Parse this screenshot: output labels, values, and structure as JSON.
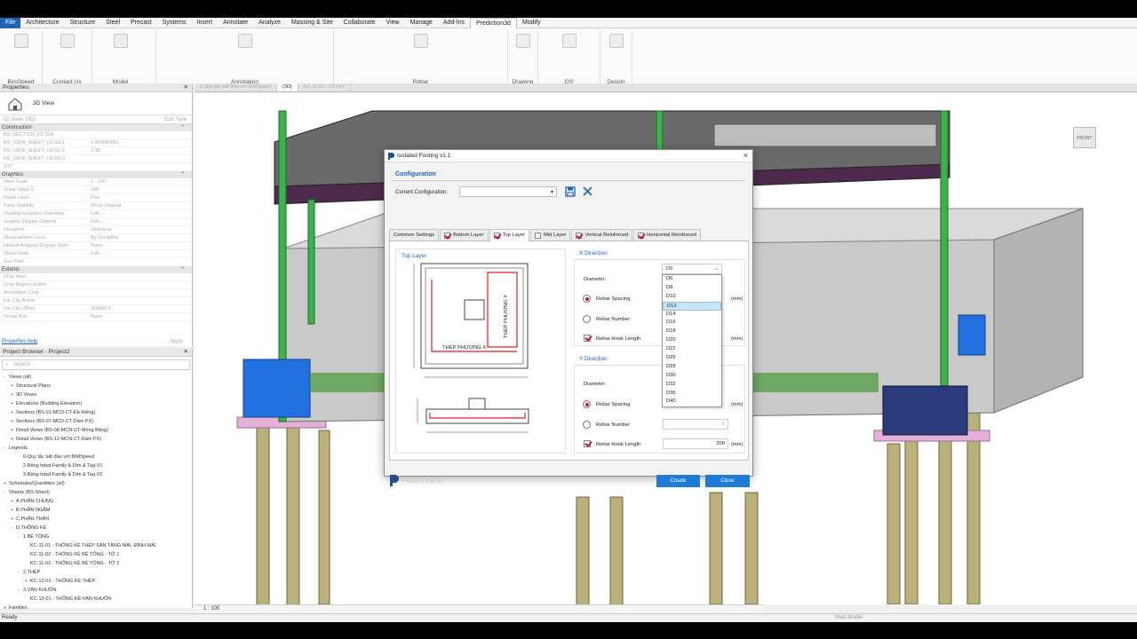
{
  "ribbon": {
    "tabs": [
      "File",
      "Architecture",
      "Structure",
      "Steel",
      "Precast",
      "Systems",
      "Insert",
      "Annotate",
      "Analyze",
      "Massing & Site",
      "Collaborate",
      "View",
      "Manage",
      "Add-Ins",
      "Prediction3d",
      "Modify"
    ],
    "groups": [
      "BimSpeed",
      "Contact Us",
      "Model",
      "Annotation",
      "Rebar",
      "Drawing",
      "QS",
      "Design"
    ]
  },
  "properties": {
    "title": "Properties",
    "view_type": "3D View",
    "view_selector": "3D View: {3D}",
    "edit_type": "Edit Type",
    "sections": {
      "construction": "Construction",
      "graphics": "Graphics",
      "extents": "Extents"
    },
    "construction_rows": [
      {
        "k": "BS_SECTION_FILTER",
        "v": ""
      },
      {
        "k": "BS_VIEW_SHEET_LEVEL1",
        "v": "0 WORKING"
      },
      {
        "k": "BS_VIEW_SHEET_LEVEL2",
        "v": "2.3D"
      },
      {
        "k": "BS_VIEW_SHEET_LEVEL3",
        "v": ""
      },
      {
        "k": "STT",
        "v": ""
      }
    ],
    "graphics_rows": [
      {
        "k": "View Scale",
        "v": "1 : 100"
      },
      {
        "k": "Scale Value    1:",
        "v": "100"
      },
      {
        "k": "Detail Level",
        "v": "Fine"
      },
      {
        "k": "Parts Visibility",
        "v": "Show Original"
      },
      {
        "k": "Visibility/Graphics Overrides",
        "v": "Edit..."
      },
      {
        "k": "Graphic Display Options",
        "v": "Edit..."
      },
      {
        "k": "Discipline",
        "v": "Structural"
      },
      {
        "k": "Show Hidden Lines",
        "v": "By Discipline"
      },
      {
        "k": "Default Analysis Display Style",
        "v": "None"
      },
      {
        "k": "Show Grids",
        "v": "Edit..."
      },
      {
        "k": "Sun Path",
        "v": ""
      }
    ],
    "extents_rows": [
      {
        "k": "Crop View",
        "v": ""
      },
      {
        "k": "Crop Region Visible",
        "v": ""
      },
      {
        "k": "Annotation Crop",
        "v": ""
      },
      {
        "k": "Far Clip Active",
        "v": ""
      },
      {
        "k": "Far Clip Offset",
        "v": "304800.0"
      },
      {
        "k": "Scope Box",
        "v": "None"
      }
    ],
    "help": "Properties help",
    "apply": "Apply"
  },
  "browser": {
    "title": "Project Browser - Project2",
    "search_placeholder": "Search",
    "nodes": [
      {
        "t": "Views (all)",
        "d": 0,
        "g": "-"
      },
      {
        "t": "Structural Plans",
        "d": 1,
        "g": "+"
      },
      {
        "t": "3D Views",
        "d": 1,
        "g": "+"
      },
      {
        "t": "Elevations (Building Elevation)",
        "d": 1,
        "g": "+"
      },
      {
        "t": "Sections (BS-01-MCD-CT-Đà Kiềng)",
        "d": 1,
        "g": "+"
      },
      {
        "t": "Sections (BS-07-MCD-CT-Dầm PX)",
        "d": 1,
        "g": "+"
      },
      {
        "t": "Detail Views (BS-08-MCN-CT-Móng Băng)",
        "d": 1,
        "g": "+"
      },
      {
        "t": "Detail Views (BS-12-MCN-CT-Dầm PX)",
        "d": 1,
        "g": "+"
      },
      {
        "t": "Legends",
        "d": 0,
        "g": "-"
      },
      {
        "t": "0-Quy tắc bắt đầu với BIMSpeed",
        "d": 2,
        "g": ""
      },
      {
        "t": "2-Bảng hdsd Family & Dim & Tag-V1",
        "d": 2,
        "g": ""
      },
      {
        "t": "3-Bảng hdsd Family & Dim & Tag-V2",
        "d": 2,
        "g": ""
      },
      {
        "t": "Schedules/Quantities (all)",
        "d": 0,
        "g": "+"
      },
      {
        "t": "Sheets (BS-Sheet)",
        "d": 0,
        "g": "-"
      },
      {
        "t": "A.PHẦN CHUNG",
        "d": 1,
        "g": "+"
      },
      {
        "t": "B.PHẦN NGẦM",
        "d": 1,
        "g": "+"
      },
      {
        "t": "C.PHẦN THÂN",
        "d": 1,
        "g": "+"
      },
      {
        "t": "D.THỐNG KÊ",
        "d": 1,
        "g": "-"
      },
      {
        "t": "1.BÊ TÔNG",
        "d": 2,
        "g": "-"
      },
      {
        "t": "KC-11-01 - THỐNG KÊ THÉP SÀN TẦNG MÁI, ĐỈNH MÁI",
        "d": 3,
        "g": ""
      },
      {
        "t": "KC-11-02 - THỐNG KÊ BÊ TÔNG - TỜ 1",
        "d": 3,
        "g": ""
      },
      {
        "t": "KC-11-03 - THỐNG KÊ BÊ TÔNG - TỜ 2",
        "d": 3,
        "g": ""
      },
      {
        "t": "2.THÉP",
        "d": 2,
        "g": "-"
      },
      {
        "t": "KC-12-01 - THỐNG KÊ THÉP",
        "d": 3,
        "g": "+"
      },
      {
        "t": "3.VÁN KHUÔN",
        "d": 2,
        "g": "-"
      },
      {
        "t": "KC-13-01 - THỐNG KÊ VÁN KHUÔN",
        "d": 3,
        "g": ""
      },
      {
        "t": "Families",
        "d": 0,
        "g": "+"
      }
    ]
  },
  "doc_tabs": [
    "0-Quy tắc bắt đầu với BIMSpeed",
    "{3D}",
    "KC-11-01 - TỔ HỢ"
  ],
  "view_cube": "FRONT",
  "view_control": {
    "scale": "1 : 100"
  },
  "status": {
    "text": "Ready",
    "main_model": "Main Model"
  },
  "dialog": {
    "title": "Isolated Footing v1.1",
    "config_section": "Configuration",
    "current_config_label": "Current Configuration:",
    "current_config_value": "",
    "tabs": [
      {
        "label": "Common Settings",
        "checkbox": false,
        "checked": false,
        "active": false
      },
      {
        "label": "Bottom Layer",
        "checkbox": true,
        "checked": true,
        "active": false
      },
      {
        "label": "Top Layer",
        "checkbox": true,
        "checked": true,
        "active": true
      },
      {
        "label": "Mid Layer",
        "checkbox": true,
        "checked": false,
        "active": false
      },
      {
        "label": "Vertical Reinforced",
        "checkbox": true,
        "checked": true,
        "active": false
      },
      {
        "label": "Horizontal Reinforced",
        "checkbox": true,
        "checked": true,
        "active": false
      }
    ],
    "preview_title": "Top Layer",
    "preview_text_x": "THÉP PHƯƠNG X",
    "preview_text_y": "THÉP PHƯƠNG Y",
    "x_direction": {
      "title": "X Direction",
      "diameter_label": "Diameter:",
      "diameter_value": "D6",
      "rebar_spacing_label": "Rebar Spacing",
      "rebar_number_label": "Rebar Number",
      "rebar_hook_length_label": "Rebar Hook Length",
      "unit": "(mm)"
    },
    "y_direction": {
      "title": "Y Direction",
      "diameter_label": "Diameter:",
      "rebar_spacing_label": "Rebar Spacing",
      "rebar_number_label": "Rebar Number",
      "rebar_number_value": "5",
      "rebar_hook_length_label": "Rebar Hook Length",
      "rebar_hook_length_value": "200",
      "unit": "(mm)"
    },
    "diameter_options": [
      "D6",
      "D8",
      "D10",
      "D12",
      "D14",
      "D16",
      "D18",
      "D20",
      "D22",
      "D25",
      "D28",
      "D30",
      "D32",
      "D36",
      "D40"
    ],
    "highlighted_option": "D12",
    "footer_brand": "PREDICTION 3D",
    "create_label": "Create",
    "close_label": "Close"
  }
}
